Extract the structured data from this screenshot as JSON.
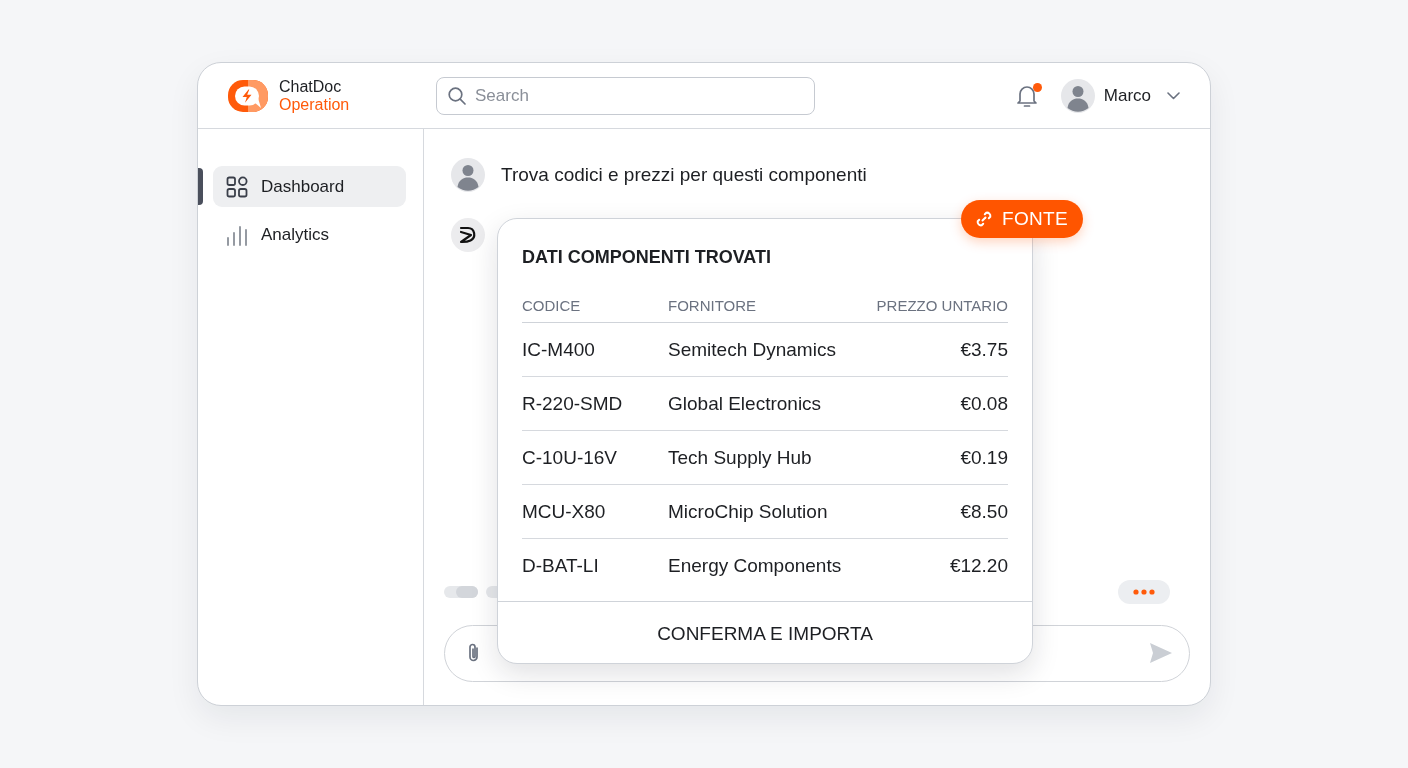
{
  "brand": {
    "name": "ChatDoc",
    "product": "Operation"
  },
  "header": {
    "search": {
      "placeholder": "Search"
    },
    "notifications": {
      "unread": true
    },
    "user": {
      "name": "Marco"
    }
  },
  "sidebar": {
    "items": [
      {
        "label": "Dashboard",
        "selected": true
      },
      {
        "label": "Analytics",
        "selected": false
      }
    ]
  },
  "chat": {
    "messages": [
      {
        "kind": "user",
        "text": "Trova codici e prezzi per questi componenti"
      },
      {
        "kind": "bot"
      }
    ],
    "result_card": {
      "source_button": "FONTE",
      "title": "DATI COMPONENTI TROVATI",
      "columns": [
        "CODICE",
        "FORNITORE",
        "PREZZO UNTARIO"
      ],
      "rows": [
        [
          "IC-M400",
          "Semitech Dynamics",
          "€3.75"
        ],
        [
          "R-220-SMD",
          "Global Electronics",
          "€0.08"
        ],
        [
          "C-10U-16V",
          "Tech Supply Hub",
          "€0.19"
        ],
        [
          "MCU-X80",
          "MicroChip Solution",
          "€8.50"
        ],
        [
          "D-BAT-LI",
          "Energy Components",
          "€12.20"
        ]
      ],
      "action": "CONFERMA E IMPORTA"
    }
  }
}
